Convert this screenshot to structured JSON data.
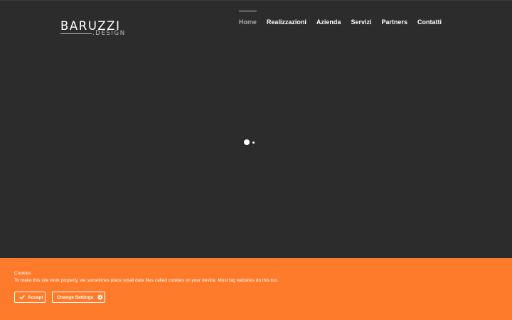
{
  "logo": {
    "main": "BARUZZI",
    "sub": ".DESIGN"
  },
  "nav": {
    "items": [
      {
        "label": "Home",
        "active": true
      },
      {
        "label": "Realizzazioni",
        "active": false
      },
      {
        "label": "Azienda",
        "active": false
      },
      {
        "label": "Servizi",
        "active": false
      },
      {
        "label": "Partners",
        "active": false
      },
      {
        "label": "Contatti",
        "active": false
      }
    ]
  },
  "cookie": {
    "title": "Cookies",
    "text": "To make this site work properly, we sometimes place small data files called cookies on your device. Most big websites do this too.",
    "accept_label": "Accept",
    "settings_label": "Change Settings",
    "accept_icon": "check-icon",
    "settings_icon": "gear-icon",
    "bar_color": "#ff7b2c"
  },
  "colors": {
    "background": "#2c2c2c",
    "accent": "#ff7b2c"
  }
}
